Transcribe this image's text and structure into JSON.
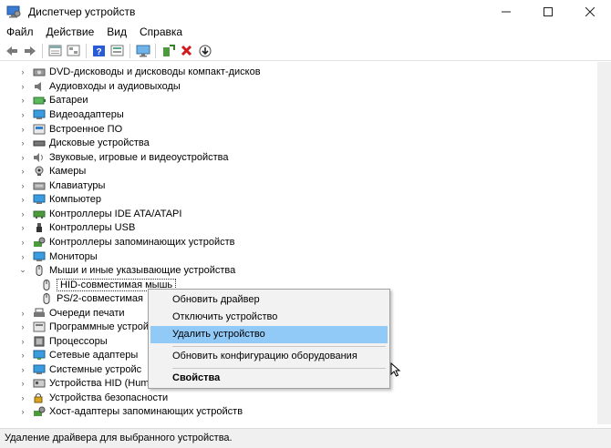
{
  "window": {
    "title": "Диспетчер устройств"
  },
  "menu": [
    "Файл",
    "Действие",
    "Вид",
    "Справка"
  ],
  "toolbar_icons": [
    "back-arrow-icon",
    "forward-arrow-icon",
    "properties-icon",
    "tree-view-icon",
    "help-icon",
    "action-view-icon",
    "monitor-icon",
    "add-driver-icon",
    "uninstall-x-icon",
    "download-icon"
  ],
  "tree": [
    {
      "label": "DVD-дисководы и дисководы компакт-дисков",
      "icon": "dvd-drive-icon",
      "expanded": false
    },
    {
      "label": "Аудиовходы и аудиовыходы",
      "icon": "speaker-icon",
      "expanded": false
    },
    {
      "label": "Батареи",
      "icon": "battery-icon",
      "expanded": false
    },
    {
      "label": "Видеоадаптеры",
      "icon": "display-adapter-icon",
      "expanded": false
    },
    {
      "label": "Встроенное ПО",
      "icon": "firmware-icon",
      "expanded": false
    },
    {
      "label": "Дисковые устройства",
      "icon": "disk-drive-icon",
      "expanded": false
    },
    {
      "label": "Звуковые, игровые и видеоустройства",
      "icon": "sound-icon",
      "expanded": false
    },
    {
      "label": "Камеры",
      "icon": "camera-icon",
      "expanded": false
    },
    {
      "label": "Клавиатуры",
      "icon": "keyboard-icon",
      "expanded": false
    },
    {
      "label": "Компьютер",
      "icon": "computer-icon",
      "expanded": false
    },
    {
      "label": "Контроллеры IDE ATA/ATAPI",
      "icon": "ide-controller-icon",
      "expanded": false
    },
    {
      "label": "Контроллеры USB",
      "icon": "usb-icon",
      "expanded": false
    },
    {
      "label": "Контроллеры запоминающих устройств",
      "icon": "storage-controller-icon",
      "expanded": false
    },
    {
      "label": "Мониторы",
      "icon": "monitor-icon",
      "expanded": false
    },
    {
      "label": "Мыши и иные указывающие устройства",
      "icon": "mouse-icon",
      "expanded": true
    },
    {
      "label": "HID-совместимая мышь",
      "icon": "mouse-icon",
      "child": true,
      "selected": true
    },
    {
      "label": "PS/2-совместимая",
      "icon": "mouse-icon",
      "child": true
    },
    {
      "label": "Очереди печати",
      "icon": "printer-icon",
      "expanded": false
    },
    {
      "label": "Программные устрой",
      "icon": "software-device-icon",
      "expanded": false
    },
    {
      "label": "Процессоры",
      "icon": "processor-icon",
      "expanded": false
    },
    {
      "label": "Сетевые адаптеры",
      "icon": "network-adapter-icon",
      "expanded": false
    },
    {
      "label": "Системные устройс",
      "icon": "system-device-icon",
      "expanded": false
    },
    {
      "label": "Устройства HID (Huma",
      "icon": "hid-icon",
      "expanded": false
    },
    {
      "label": "Устройства безопасности",
      "icon": "security-device-icon",
      "expanded": false
    },
    {
      "label": "Хост-адаптеры запоминающих устройств",
      "icon": "storage-host-icon",
      "expanded": false
    }
  ],
  "context_menu": [
    {
      "label": "Обновить драйвер"
    },
    {
      "label": "Отключить устройство"
    },
    {
      "label": "Удалить устройство",
      "hover": true
    },
    {
      "separator": true
    },
    {
      "label": "Обновить конфигурацию оборудования"
    },
    {
      "separator": true
    },
    {
      "label": "Свойства",
      "bold": true
    }
  ],
  "statusbar": {
    "text": "Удаление драйвера для выбранного устройства."
  },
  "colors": {
    "hover": "#91c9f7",
    "menu_bg": "#f2f2f2",
    "status_bg": "#f0f0f0"
  }
}
